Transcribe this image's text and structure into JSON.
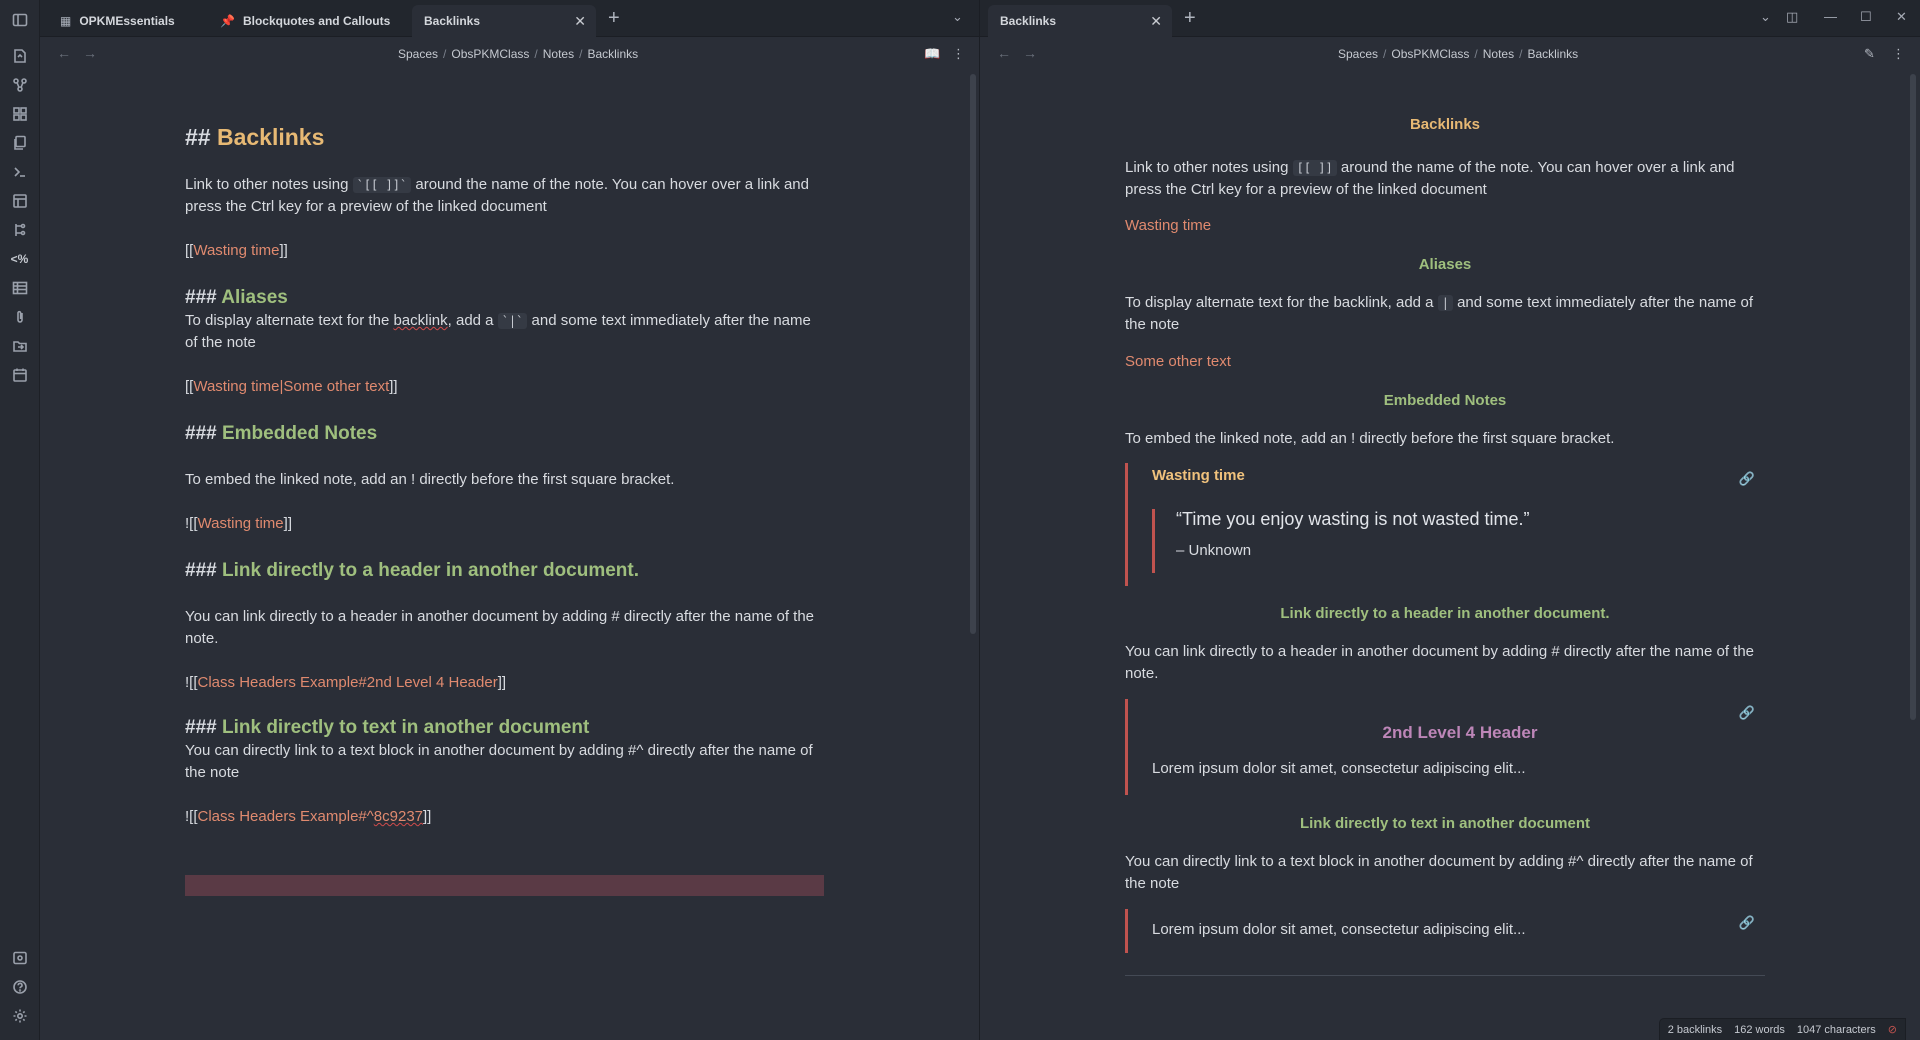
{
  "ribbon": {
    "top_icons": [
      "sidebar-toggle-icon",
      "open-quick-switcher-icon",
      "graph-view-icon",
      "canvas-icon",
      "templates-icon",
      "command-palette-icon",
      "layout-icon",
      "tag-icon",
      "template-tag-icon",
      "table-icon",
      "attach-icon",
      "move-file-icon",
      "daily-note-icon"
    ],
    "bottom_icons": [
      "vault-switch-icon",
      "help-icon",
      "settings-icon"
    ]
  },
  "left_pane": {
    "tabs": [
      {
        "label": "OPKMEssentials",
        "icon": "grid-icon"
      },
      {
        "label": "Blockquotes and Callouts",
        "icon": "pin-icon"
      },
      {
        "label": "Backlinks",
        "active": true
      }
    ],
    "breadcrumb": [
      "Spaces",
      "ObsPKMClass",
      "Notes",
      "Backlinks"
    ],
    "source": {
      "h2_marker": "## ",
      "h2": "Backlinks",
      "intro_a": "Link to other notes using ",
      "intro_code": "`[[ ]]`",
      "intro_b": " around the name of the note.  You can hover over a link and press the Ctrl key for a preview of the linked document",
      "link1_open": "[[",
      "link1": "Wasting time",
      "link1_close": "]]",
      "h3_marker": "### ",
      "aliases_h": "Aliases",
      "aliases_a": "To display alternate text for the ",
      "aliases_sq": "backlink",
      "aliases_b": ", add a ",
      "aliases_code": "`|`",
      "aliases_c": " and some text immediately after the name of the note",
      "link2_open": "[[",
      "link2": "Wasting time|Some other text",
      "link2_close": "]]",
      "embedded_h": "Embedded Notes",
      "embedded_text": "To embed the linked note, add an ! directly before the first square bracket.",
      "link3_open": "![[",
      "link3": "Wasting time",
      "link3_close": "]]",
      "header_link_h": "Link directly to a header in another document.",
      "header_link_text": "You can link directly to a header in another document by adding # directly after the name of the note.",
      "link4_open": "![[",
      "link4": "Class Headers Example#2nd Level 4 Header",
      "link4_close": "]]",
      "text_link_h": "Link directly to text in another document",
      "text_link_text": "You can directly link to a text block in another document by adding #^ directly after the name of the note",
      "link5_open": "![[",
      "link5_a": "Class Headers Example#^",
      "link5_sq": "8c9237",
      "link5_close": "]]"
    }
  },
  "right_pane": {
    "tab": "Backlinks",
    "breadcrumb": [
      "Spaces",
      "ObsPKMClass",
      "Notes",
      "Backlinks"
    ],
    "reading": {
      "h1": "Backlinks",
      "intro_a": "Link to other notes using ",
      "intro_code": "[[ ]]",
      "intro_b": " around the name of the note. You can hover over a link and press the Ctrl key for a preview of the linked document",
      "link1": "Wasting time",
      "aliases_h": "Aliases",
      "aliases_a": "To display alternate text for the backlink, add a ",
      "aliases_code": "|",
      "aliases_b": " and some text immediately after the name of the note",
      "link2": "Some other text",
      "embedded_h": "Embedded Notes",
      "embedded_text": "To embed the linked note, add an ! directly before the first square bracket.",
      "embed1_title": "Wasting time",
      "quote": "“Time you enjoy wasting is not wasted time.”",
      "quote_author": "– Unknown",
      "header_link_h": "Link directly to a header in another document.",
      "header_link_text": "You can link directly to a header in another document by adding # directly after the name of the note.",
      "embed2_h": "2nd Level 4 Header",
      "embed2_text": "Lorem ipsum dolor sit amet, consectetur adipiscing elit...",
      "text_link_h": "Link directly to text in another document",
      "text_link_text": "You can directly link to a text block in another document by adding #^ directly after the name of the note",
      "embed3_text": "Lorem ipsum dolor sit amet, consectetur adipiscing elit..."
    }
  },
  "status": {
    "backlinks": "2 backlinks",
    "words": "162 words",
    "characters": "1047 characters"
  },
  "colors": {
    "h2": "#e7b974",
    "h3": "#9fbf7e",
    "h4": "#bd86b8",
    "link": "#e08a6f",
    "embed_border": "#c0534f"
  }
}
